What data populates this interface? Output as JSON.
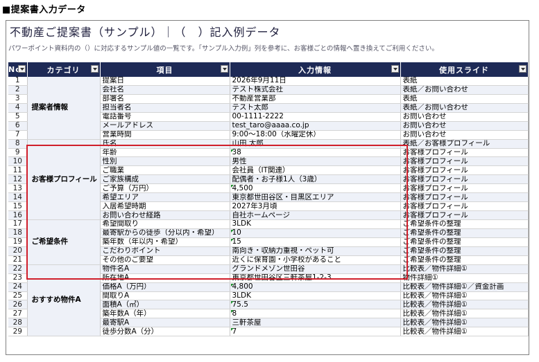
{
  "heading": "■提案書入力データ",
  "doc_title": "不動産ご提案書（サンプル）｜（　）記入例データ",
  "doc_desc": "パワーポイント資料内の（）に対応するサンプル値の一覧です。「サンプル入力例」列を参考に、お客様ごとの情報へ置き換えてご利用ください。",
  "columns": [
    "No",
    "カテゴリ",
    "項目",
    "入力情報",
    "使用スライド"
  ],
  "categories": [
    "提案者情報",
    "お客様プロフィール",
    "ご希望条件",
    "おすすめ物件A"
  ],
  "rows": [
    {
      "no": "1",
      "item": "提案日",
      "value": "2026年9月11日",
      "slide": "表紙"
    },
    {
      "no": "2",
      "item": "会社名",
      "value": "テスト株式会社",
      "slide": "表紙／お問い合わせ"
    },
    {
      "no": "3",
      "item": "部署名",
      "value": "不動産営業部",
      "slide": "表紙"
    },
    {
      "no": "4",
      "item": "担当者名",
      "value": "テスト太郎",
      "slide": "表紙／お問い合わせ"
    },
    {
      "no": "5",
      "item": "電話番号",
      "value": "00-1111-2222",
      "slide": "お問い合わせ"
    },
    {
      "no": "6",
      "item": "メールアドレス",
      "value": "test_taro@aaaa.co.jp",
      "slide": "お問い合わせ"
    },
    {
      "no": "7",
      "item": "営業時間",
      "value": "9:00～18:00（水曜定休）",
      "slide": "お問い合わせ"
    },
    {
      "no": "8",
      "item": "氏名",
      "value": "山田 太郎",
      "slide": "表紙／お客様プロフィール"
    },
    {
      "no": "9",
      "item": "年齢",
      "value": "38",
      "slide": "お客様プロフィール"
    },
    {
      "no": "10",
      "item": "性別",
      "value": "男性",
      "slide": "お客様プロフィール"
    },
    {
      "no": "11",
      "item": "ご職業",
      "value": "会社員（IT関連）",
      "slide": "お客様プロフィール"
    },
    {
      "no": "12",
      "item": "ご家族構成",
      "value": "配偶者・お子様1人（3歳）",
      "slide": "お客様プロフィール"
    },
    {
      "no": "13",
      "item": "ご予算（万円）",
      "value": "4,500",
      "slide": "お客様プロフィール"
    },
    {
      "no": "14",
      "item": "希望エリア",
      "value": "東京都世田谷区・目黒区エリア",
      "slide": "お客様プロフィール"
    },
    {
      "no": "15",
      "item": "入居希望時期",
      "value": "2027年3月頃",
      "slide": "お客様プロフィール"
    },
    {
      "no": "16",
      "item": "お問い合わせ経路",
      "value": "自社ホームページ",
      "slide": "お客様プロフィール"
    },
    {
      "no": "17",
      "item": "希望間取り",
      "value": "3LDK",
      "slide": "ご希望条件の整理"
    },
    {
      "no": "18",
      "item": "最寄駅からの徒歩（分以内・希望）",
      "value": "10",
      "slide": "ご希望条件の整理"
    },
    {
      "no": "19",
      "item": "築年数（年以内・希望）",
      "value": "15",
      "slide": "ご希望条件の整理"
    },
    {
      "no": "20",
      "item": "こだわりポイント",
      "value": "南向き・収納力重視・ペット可",
      "slide": "ご希望条件の整理"
    },
    {
      "no": "21",
      "item": "その他のご要望",
      "value": "近くに保育園・小学校があること",
      "slide": "ご希望条件の整理"
    },
    {
      "no": "22",
      "item": "物件名A",
      "value": "グランドメゾン世田谷",
      "slide": "比較表／物件詳細①"
    },
    {
      "no": "23",
      "item": "所在地A",
      "value": "東京都世田谷区三軒茶屋1-2-3",
      "slide": "物件詳細①"
    },
    {
      "no": "24",
      "item": "価格A（万円）",
      "value": "4,800",
      "slide": "比較表／物件詳細①／資金計画"
    },
    {
      "no": "25",
      "item": "間取りA",
      "value": "3LDK",
      "slide": "比較表／物件詳細①"
    },
    {
      "no": "26",
      "item": "面積A（㎡）",
      "value": "75.5",
      "slide": "比較表／物件詳細①"
    },
    {
      "no": "27",
      "item": "築年数A（年）",
      "value": "8",
      "slide": "比較表／物件詳細①"
    },
    {
      "no": "28",
      "item": "最寄駅A",
      "value": "三軒茶屋",
      "slide": "比較表／物件詳細①"
    },
    {
      "no": "29",
      "item": "徒歩分数A（分）",
      "value": "7",
      "slide": "比較表／物件詳細①"
    }
  ],
  "colors": {
    "header_bg": "#1e2a56",
    "band": "#eef1f8",
    "highlight": "#d01e2a",
    "numeric_flag": "#1a8c2a"
  }
}
